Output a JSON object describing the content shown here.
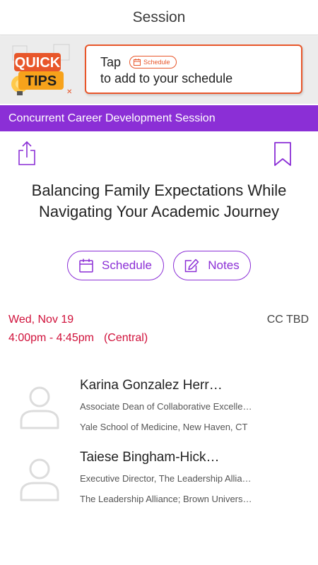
{
  "header": {
    "title": "Session"
  },
  "tip": {
    "badge_line1": "QUICK",
    "badge_line2": "TIPS",
    "tap_label": "Tap",
    "chip_label": "Schedule",
    "line2": "to add to your schedule"
  },
  "session": {
    "category": "Concurrent Career Development Session",
    "title": "Balancing Family Expectations While Navigating Your Academic Journey",
    "date": "Wed, Nov 19",
    "time": "4:00pm - 4:45pm",
    "timezone": "(Central)",
    "room": "CC TBD"
  },
  "actions": {
    "schedule_label": "Schedule",
    "notes_label": "Notes"
  },
  "speakers": [
    {
      "name": "Karina Gonzalez Herr…",
      "title": "Associate Dean of Collaborative Excelle…",
      "org": "Yale School of Medicine, New Haven, CT"
    },
    {
      "name": "Taiese Bingham-Hick…",
      "title": "Executive Director, The Leadership Allia…",
      "org": "The Leadership Alliance; Brown Univers…"
    }
  ],
  "colors": {
    "accent": "#8b2fd6",
    "date": "#d0103a",
    "tip_border": "#e8562a"
  }
}
